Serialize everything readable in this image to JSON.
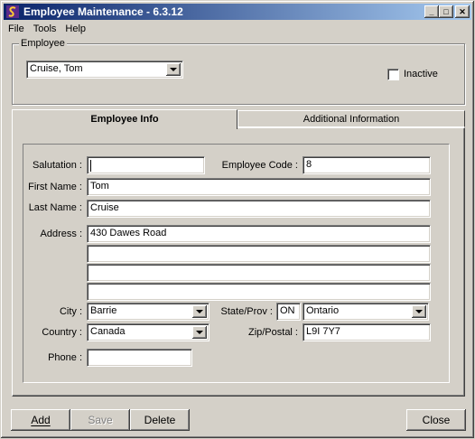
{
  "window": {
    "title": "Employee Maintenance - 6.3.12"
  },
  "titlebar": {
    "minimize": "_",
    "maximize": "□",
    "close": "✕"
  },
  "menu": [
    "File",
    "Tools",
    "Help"
  ],
  "employee_group": {
    "label": "Employee",
    "selected": "Cruise, Tom",
    "inactive_label": "Inactive",
    "inactive_checked": false
  },
  "tabs": [
    {
      "label": "Employee Info",
      "active": true
    },
    {
      "label": "Additional Information",
      "active": false
    }
  ],
  "form": {
    "salutation_label": "Salutation :",
    "salutation_value": "",
    "employee_code_label": "Employee Code :",
    "employee_code_value": "8",
    "first_name_label": "First Name :",
    "first_name_value": "Tom",
    "last_name_label": "Last Name :",
    "last_name_value": "Cruise",
    "address_label": "Address :",
    "address_lines": [
      "430 Dawes Road",
      "",
      "",
      ""
    ],
    "city_label": "City :",
    "city_value": "Barrie",
    "state_label": "State/Prov :",
    "state_code": "ON",
    "state_name": "Ontario",
    "country_label": "Country :",
    "country_value": "Canada",
    "zip_label": "Zip/Postal :",
    "zip_value": "L9I 7Y7",
    "phone_label": "Phone :",
    "phone_value": ""
  },
  "buttons": {
    "add": "Add",
    "save": "Save",
    "delete": "Delete",
    "close": "Close"
  }
}
